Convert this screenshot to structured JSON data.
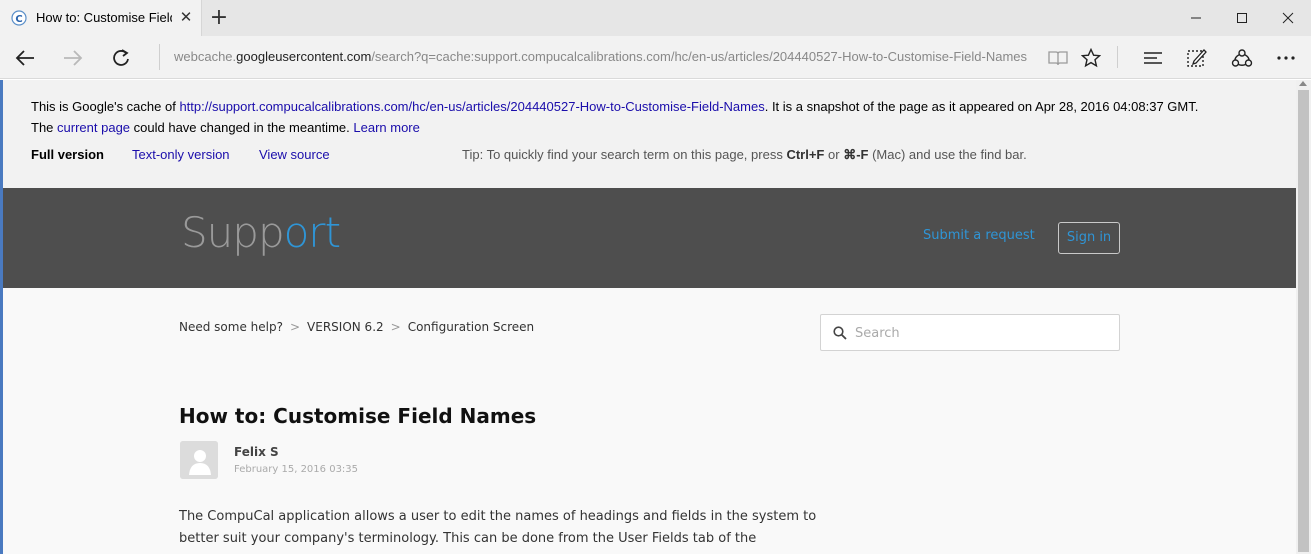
{
  "browser": {
    "tab_title": "How to: Customise Field Names",
    "url_prefix": "webcache.",
    "url_host": "googleusercontent.com",
    "url_rest": "/search?q=cache:support.compucalcalibrations.com/hc/en-us/articles/204440527-How-to-Customise-Field-Names",
    "icons": [
      "back-icon",
      "forward-icon",
      "refresh-icon",
      "reading-view-icon",
      "favorite-star-icon",
      "hub-icon",
      "web-note-icon",
      "share-icon",
      "more-icon"
    ]
  },
  "cache": {
    "line1_prefix": "This is Google's cache of",
    "cached_url": "http://support.compucalcalibrations.com/hc/en-us/articles/204440527-How-to-Customise-Field-Names",
    "line1_suffix": ". It is a snapshot of the page as it appeared on Apr 28, 2016 04:08:37 GMT.",
    "line2_prefix": "The",
    "current_page": "current page",
    "line2_middle": "could have changed in the meantime.",
    "learn_more": "Learn more",
    "full_version": "Full version",
    "text_only": "Text-only version",
    "view_source": "View source",
    "tip_prefix": "Tip: To quickly find your search term on this page, press",
    "tip_key1": "Ctrl+F",
    "tip_or": "or",
    "tip_key2": "⌘-F",
    "tip_suffix": "(Mac) and use the find bar."
  },
  "site": {
    "logo_part1": "Supp",
    "logo_part2": "ort",
    "submit_request": "Submit a request",
    "sign_in": "Sign in"
  },
  "breadcrumb": {
    "items": [
      "Need some help?",
      "VERSION 6.2",
      "Configuration Screen"
    ],
    "separator": ">"
  },
  "search": {
    "placeholder": "Search"
  },
  "article": {
    "title": "How to: Customise Field Names",
    "author": "Felix S",
    "date": "February 15, 2016 03:35",
    "body_line1": "The CompuCal application allows a user to edit the names of headings and fields in the system to",
    "body_line2": "better suit your company's terminology. This can be done from the User Fields tab of the"
  },
  "colors": {
    "accent": "#2f95d6",
    "header_bg": "#4e4e4e",
    "link": "#1a0dab"
  }
}
